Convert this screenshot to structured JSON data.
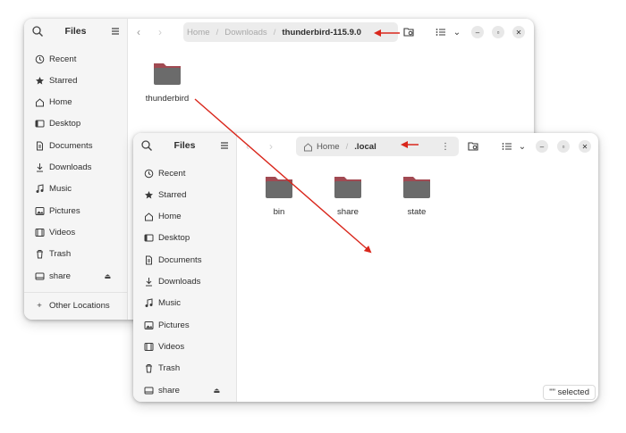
{
  "annotation_color": "#d9271c",
  "folder_colors": {
    "body": "#6b6b6b",
    "tab": "#a14a52"
  },
  "window_back": {
    "sidebar_title": "Files",
    "places": [
      {
        "label": "Recent",
        "icon": "clock-icon"
      },
      {
        "label": "Starred",
        "icon": "star-icon"
      },
      {
        "label": "Home",
        "icon": "home-icon"
      },
      {
        "label": "Desktop",
        "icon": "desktop-icon"
      },
      {
        "label": "Documents",
        "icon": "document-icon"
      },
      {
        "label": "Downloads",
        "icon": "download-icon"
      },
      {
        "label": "Music",
        "icon": "music-icon"
      },
      {
        "label": "Pictures",
        "icon": "picture-icon"
      },
      {
        "label": "Videos",
        "icon": "video-icon"
      },
      {
        "label": "Trash",
        "icon": "trash-icon"
      },
      {
        "label": "share",
        "icon": "drive-icon"
      }
    ],
    "other_locations": "Other Locations",
    "breadcrumbs": [
      "Home",
      "Downloads",
      "thunderbird-115.9.0"
    ],
    "folders": [
      "thunderbird"
    ]
  },
  "window_front": {
    "sidebar_title": "Files",
    "places": [
      {
        "label": "Recent",
        "icon": "clock-icon"
      },
      {
        "label": "Starred",
        "icon": "star-icon"
      },
      {
        "label": "Home",
        "icon": "home-icon"
      },
      {
        "label": "Desktop",
        "icon": "desktop-icon"
      },
      {
        "label": "Documents",
        "icon": "document-icon"
      },
      {
        "label": "Downloads",
        "icon": "download-icon"
      },
      {
        "label": "Music",
        "icon": "music-icon"
      },
      {
        "label": "Pictures",
        "icon": "picture-icon"
      },
      {
        "label": "Videos",
        "icon": "video-icon"
      },
      {
        "label": "Trash",
        "icon": "trash-icon"
      },
      {
        "label": "share",
        "icon": "drive-icon"
      }
    ],
    "breadcrumbs": [
      "Home",
      ".local"
    ],
    "folders": [
      "bin",
      "share",
      "state"
    ],
    "status": "\"\" selected"
  }
}
